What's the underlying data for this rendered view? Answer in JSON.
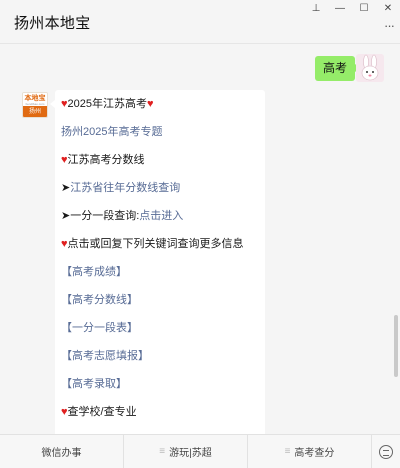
{
  "window": {
    "title": "扬州本地宝",
    "pin_icon": "⊥",
    "minimize_icon": "—",
    "maximize_icon": "☐",
    "close_icon": "✕",
    "menu_icon": "···"
  },
  "user_message": {
    "text": "高考"
  },
  "bot_avatar": {
    "top_text": "本地宝",
    "top_sub": "bendibao.com",
    "bottom_text": "扬州"
  },
  "reply": {
    "heart": "♥",
    "arrow": "➤",
    "line1": "2025年江苏高考",
    "line2": "扬州2025年高考专题",
    "line3": "江苏高考分数线",
    "line4": "江苏省往年分数线查询",
    "line5_prefix": "一分一段查询:",
    "line5_link": "点击进入",
    "line6": "点击或回复下列关键词查询更多信息",
    "kw1": "【高考成绩】",
    "kw2": "【高考分数线】",
    "kw3": "【一分一段表】",
    "kw4": "【高考志愿填报】",
    "kw5": "【高考录取】",
    "line_last": "查学校/查专业"
  },
  "bottom_menu": {
    "tab1": "微信办事",
    "tab2": "游玩|苏超",
    "tab3": "高考查分",
    "tab_sep": "≡",
    "keyboard_icon": "keyboard-icon"
  }
}
